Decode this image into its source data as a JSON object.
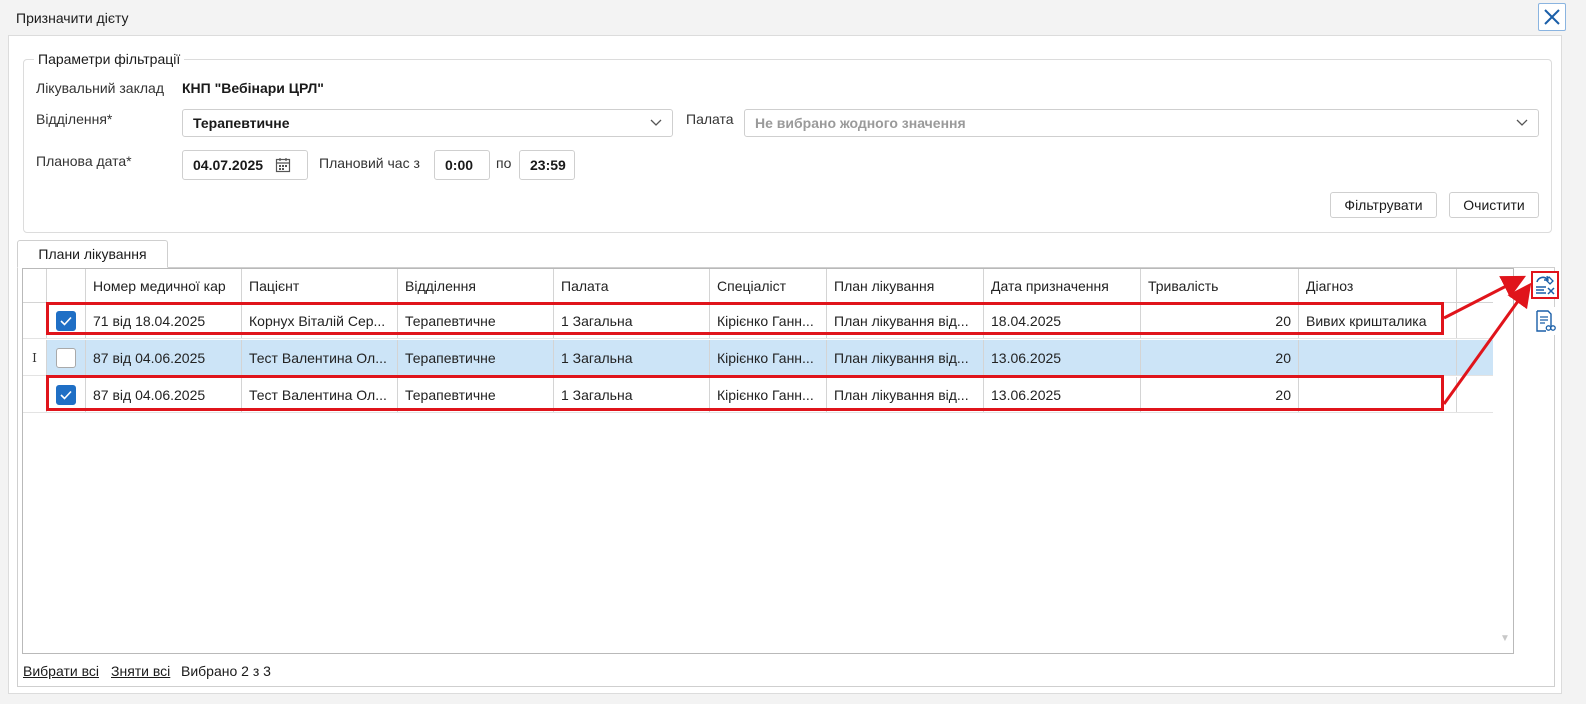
{
  "window": {
    "title": "Призначити дієту"
  },
  "filter": {
    "legend": "Параметри фільтрації",
    "facility_label": "Лікувальний заклад",
    "facility_value": "КНП \"Вебінари ЦРЛ\"",
    "department_label": "Відділення*",
    "department_value": "Терапевтичне",
    "ward_label": "Палата",
    "ward_placeholder": "Не вибрано жодного значення",
    "date_label": "Планова дата*",
    "date_value": "04.07.2025",
    "time_label": "Плановий час з",
    "time_from": "0:00",
    "time_to_label": "по",
    "time_to": "23:59",
    "filter_button": "Фільтрувати",
    "clear_button": "Очистити"
  },
  "tabs": [
    {
      "label": "Плани лікування",
      "active": true
    }
  ],
  "table": {
    "columns": [
      "Номер медичної кар",
      "Пацієнт",
      "Відділення",
      "Палата",
      "Спеціаліст",
      "План лікування",
      "Дата призначення",
      "Тривалість",
      "Діагноз"
    ],
    "rows": [
      {
        "checked": true,
        "selected": false,
        "cells": [
          "71 від 18.04.2025",
          "Корнух Віталій Сер...",
          "Терапевтичне",
          "1 Загальна",
          "Кірієнко Ганн...",
          "План лікування від...",
          "18.04.2025",
          "20",
          "Вивих кришталика"
        ]
      },
      {
        "checked": false,
        "selected": true,
        "cells": [
          "87 від 04.06.2025",
          "Тест Валентина Ол...",
          "Терапевтичне",
          "1 Загальна",
          "Кірієнко Ганн...",
          "План лікування від...",
          "13.06.2025",
          "20",
          ""
        ]
      },
      {
        "checked": true,
        "selected": false,
        "cells": [
          "87 від 04.06.2025",
          "Тест Валентина Ол...",
          "Терапевтичне",
          "1 Загальна",
          "Кірієнко Ганн...",
          "План лікування від...",
          "13.06.2025",
          "20",
          ""
        ]
      }
    ],
    "current_row_marker": "I"
  },
  "footer": {
    "select_all": "Вибрати всі",
    "deselect_all": "Зняти всі",
    "selected_count": "Вибрано 2 з 3"
  },
  "colors": {
    "highlight": "#e0141b",
    "selected_row": "#cce4f7",
    "checkbox_checked": "#1f6fc5"
  },
  "icons": [
    "close-icon",
    "calendar-icon",
    "chevron-down-icon",
    "assign-diet-icon",
    "document-search-icon",
    "checkmark-icon"
  ]
}
